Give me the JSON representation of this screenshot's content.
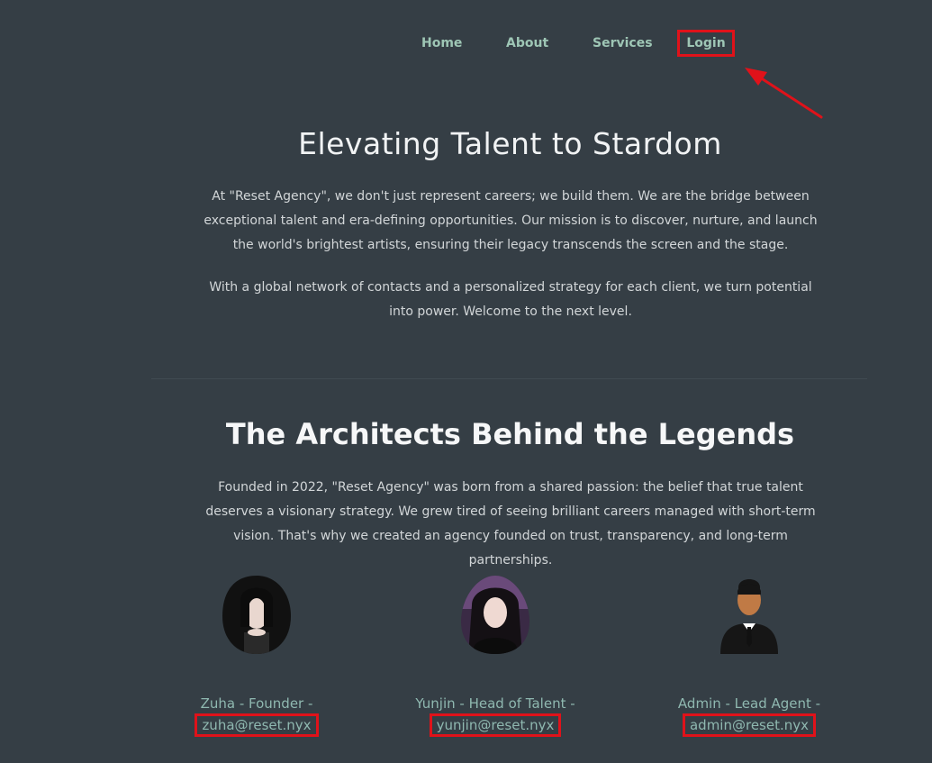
{
  "nav": {
    "items": [
      {
        "label": "Home"
      },
      {
        "label": "About"
      },
      {
        "label": "Services"
      },
      {
        "label": "Login"
      }
    ]
  },
  "hero": {
    "title": "Elevating Talent to Stardom",
    "paragraph1": "At \"Reset Agency\", we don't just represent careers; we build them. We are the bridge between exceptional talent and era-defining opportunities. Our mission is to discover, nurture, and launch the world's brightest artists, ensuring their legacy transcends the screen and the stage.",
    "paragraph2": "With a global network of contacts and a personalized strategy for each client, we turn potential into power. Welcome to the next level."
  },
  "architects": {
    "title": "The Architects Behind the Legends",
    "paragraph": "Founded in 2022, \"Reset Agency\" was born from a shared passion: the belief that true talent deserves a visionary strategy. We grew tired of seeing brilliant careers managed with short-term vision. That's why we created an agency founded on trust, transparency, and long-term partnerships.",
    "members": [
      {
        "name": "Zuha - Founder -",
        "email": "zuha@reset.nyx"
      },
      {
        "name": "Yunjin - Head of Talent -",
        "email": "yunjin@reset.nyx"
      },
      {
        "name": "Admin - Lead Agent -",
        "email": "admin@reset.nyx"
      }
    ]
  },
  "colors": {
    "background": "#353e45",
    "accent": "#9ec6b5",
    "highlight": "#e0121a"
  }
}
